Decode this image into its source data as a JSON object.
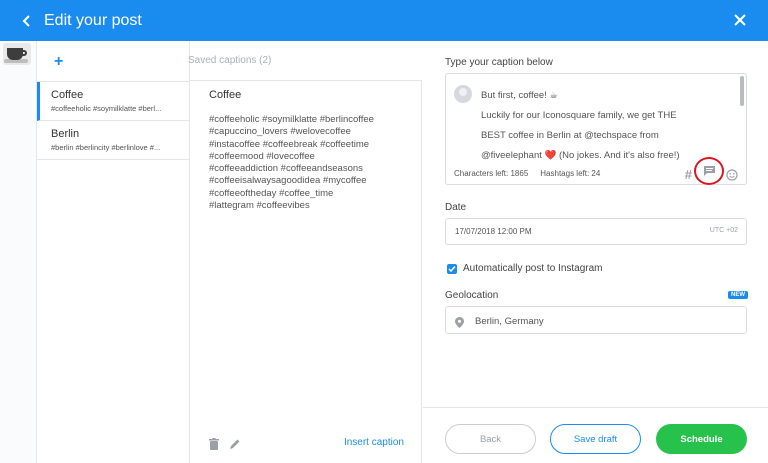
{
  "header": {
    "title": "Edit your post",
    "back_icon": "chevron-left-icon",
    "close_icon": "close-icon",
    "color": "#1a8cf0"
  },
  "captions_panel": {
    "add_label": "+",
    "saved_header": "Saved captions (2)",
    "items": [
      {
        "name": "Coffee",
        "tags": "#coffeeholic #soymilklatte #berl..."
      },
      {
        "name": "Berlin",
        "tags": "#berlin #berlincity #berlinlove #..."
      }
    ]
  },
  "caption_view": {
    "title": "Coffee",
    "body": "#coffeeholic #soymilklatte #berlincoffee\n#capuccino_lovers #welovecoffee\n#instacoffee #coffeebreak #coffeetime\n#coffeemood #lovecoffee\n#coffeeaddiction #coffeeandseasons\n#coffeeisalwaysagoodidea #mycoffee\n#coffeeoftheday #coffee_time\n#lattegram #coffeevibes",
    "insert_label": "Insert caption"
  },
  "editor": {
    "caption_label": "Type your caption below",
    "caption_lines": [
      "But first, coffee! ☕",
      "Luckily for our Iconosquare family, we get THE",
      "BEST coffee in Berlin at @techspace from",
      "@fiveelephant ❤️ (No jokes. And it's also free!)"
    ],
    "chars_left": "Characters left: 1865",
    "hashtags_left": "Hashtags left: 24",
    "date_label": "Date",
    "date_value": "17/07/2018 12:00 PM",
    "timezone": "UTC +02",
    "auto_post_label": "Automatically post to Instagram",
    "geo_label": "Geolocation",
    "new_badge": "NEW",
    "geo_value": "Berlin, Germany",
    "highlight_color": "#e0141e"
  },
  "footer": {
    "back_label": "Back",
    "draft_label": "Save draft",
    "schedule_label": "Schedule",
    "schedule_color": "#27c24c"
  }
}
